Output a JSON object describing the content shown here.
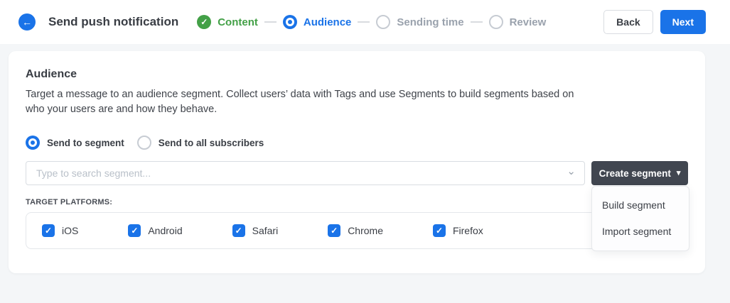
{
  "icons": {
    "back_arrow": "←",
    "check": "✓",
    "caret_down": "▾",
    "chevron_down": "⌄"
  },
  "colors": {
    "accent_blue": "#1a73e8",
    "success_green": "#43a047",
    "dark_button": "#414650",
    "page_background": "#f4f6f8"
  },
  "header": {
    "title": "Send push notification",
    "back_label": "Back",
    "next_label": "Next",
    "steps": [
      {
        "label": "Content",
        "state": "completed"
      },
      {
        "label": "Audience",
        "state": "active"
      },
      {
        "label": "Sending time",
        "state": "upcoming"
      },
      {
        "label": "Review",
        "state": "upcoming"
      }
    ]
  },
  "panel": {
    "heading": "Audience",
    "description": "Target a message to an audience segment. Collect users’ data with Tags and use Segments to build segments based on who your users are and how they behave.",
    "radio_options": [
      {
        "label": "Send to segment",
        "selected": true
      },
      {
        "label": "Send to all subscribers",
        "selected": false
      }
    ],
    "segment_search": {
      "placeholder": "Type to search segment...",
      "value": ""
    },
    "create_segment_label": "Create segment",
    "dropdown_items": [
      "Build segment",
      "Import segment"
    ],
    "target_platforms_label": "TARGET PLATFORMS:",
    "platforms": [
      {
        "label": "iOS",
        "checked": true
      },
      {
        "label": "Android",
        "checked": true
      },
      {
        "label": "Safari",
        "checked": true
      },
      {
        "label": "Chrome",
        "checked": true
      },
      {
        "label": "Firefox",
        "checked": true
      }
    ]
  }
}
